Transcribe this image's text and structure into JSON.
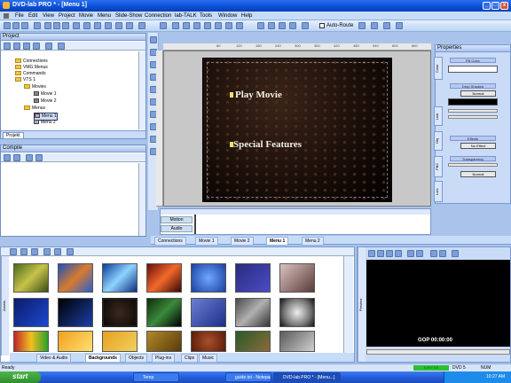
{
  "window": {
    "title": "DVD-lab PRO * - [Menu 1]"
  },
  "menubar": [
    "File",
    "Edit",
    "View",
    "Project",
    "Movie",
    "Menu",
    "Slide-Show",
    "Connection",
    "lab-TALK",
    "Tools",
    "Window",
    "Help"
  ],
  "toolbar": {
    "auto_route": "Auto-Route"
  },
  "project": {
    "title": "Project",
    "tab": "Projekt",
    "tree": [
      {
        "label": "Connections",
        "type": "folder",
        "indent": 1
      },
      {
        "label": "VMG Menus",
        "type": "folder",
        "indent": 1
      },
      {
        "label": "Commands",
        "type": "folder",
        "indent": 1
      },
      {
        "label": "VTS 1",
        "type": "folder",
        "indent": 1
      },
      {
        "label": "Movies",
        "type": "folder",
        "indent": 2
      },
      {
        "label": "Movie 1",
        "type": "item",
        "indent": 3
      },
      {
        "label": "Movie 2",
        "type": "item",
        "indent": 3
      },
      {
        "label": "Menus",
        "type": "folder",
        "indent": 2
      },
      {
        "label": "Menu 1",
        "type": "item",
        "indent": 3,
        "selected": true
      },
      {
        "label": "Menu 2",
        "type": "item",
        "indent": 3
      }
    ]
  },
  "compile": {
    "title": "Compile"
  },
  "ruler": [
    "60",
    "120",
    "180",
    "240",
    "300",
    "360",
    "420",
    "480",
    "540",
    "600",
    "660"
  ],
  "canvas": {
    "button1": "Play Movie",
    "button2": "Special Features"
  },
  "timeline": {
    "rows": [
      "Motion",
      "Audio"
    ]
  },
  "doc_tabs": [
    "Connections",
    "Movie 1",
    "Movie 2",
    "Menu 1",
    "Menu 2"
  ],
  "properties": {
    "title": "Properties",
    "fill_color": "Fill Color",
    "drop_shadow": "Drop Shadow",
    "drop_shadow_mode": "Normal",
    "effects": "Effects",
    "effect_value": "No Effect",
    "transparency": "Transparency",
    "transparency_mode": "Normal",
    "vtabs": [
      "Color",
      "Link",
      "Obj",
      "PBC",
      "Lvrs"
    ]
  },
  "assets": {
    "side_label": "Assets",
    "tabs": [
      "Video & Audio",
      "Backgrounds",
      "Objects",
      "Plug-ins",
      "Clips",
      "Music"
    ],
    "active_tab": "Backgrounds"
  },
  "preview": {
    "side_label": "Preview",
    "gop": "GOP 00:00:00"
  },
  "status": {
    "left": "Ready",
    "mem": "5,897 KB",
    "dvd": "DVD 5",
    "num": "NUM"
  },
  "taskbar": {
    "start": "start",
    "tasks": [
      "Temp",
      "guide.txt - Notepad",
      "DVD-lab PRO * - [Menu...]"
    ],
    "clock": "10:27 AM"
  },
  "colors": {
    "accent": "#0a4fd6",
    "panel": "#c9dbf7",
    "status_green": "#2cc12c"
  }
}
